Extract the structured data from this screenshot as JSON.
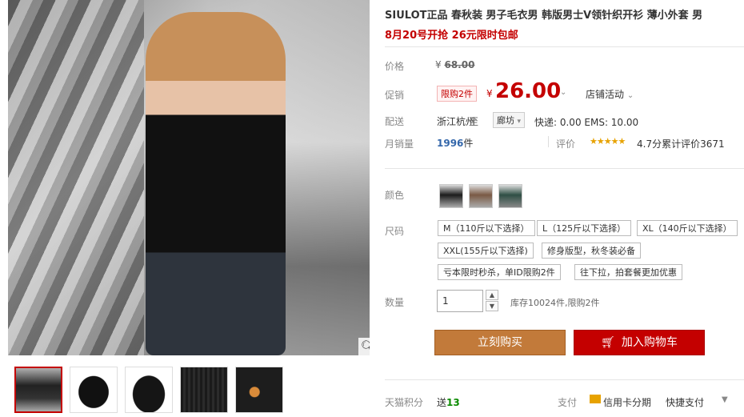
{
  "product": {
    "title": "SIULOT正品 春秋装 男子毛衣男 韩版男士V领针织开衫 薄小外套 男",
    "subtitle": "8月20号开抢 26元限时包邮"
  },
  "price": {
    "label": "价格",
    "currency": "¥",
    "original": "68.00"
  },
  "promo": {
    "label": "促销",
    "limit_tag": "限购2件",
    "currency": "¥",
    "value": "26.00",
    "store_activity": "店铺活动"
  },
  "shipping": {
    "label": "配送",
    "from": "浙江杭州",
    "to_word": "至",
    "destination": "廊坊",
    "fee": "快递: 0.00 EMS: 10.00"
  },
  "sales": {
    "label": "月销量",
    "count": "1996",
    "unit": "件",
    "rating_label": "评价",
    "stars": "★★★★★",
    "rating_text": "4.7分累计评价3671"
  },
  "color": {
    "label": "颜色"
  },
  "size": {
    "label": "尺码",
    "options": [
      "M（110斤以下选择）",
      "L（125斤以下选择）",
      "XL（140斤以下选择）",
      "XXL(155斤以下选择)",
      "修身版型，秋冬装必备",
      "亏本限时秒杀，单ID限购2件",
      "往下拉，拍套餐更加优惠"
    ]
  },
  "quantity": {
    "label": "数量",
    "value": "1",
    "stock": "库存10024件,限购2件"
  },
  "actions": {
    "buy_now": "立刻购买",
    "add_to_cart": "加入购物车"
  },
  "points": {
    "label": "天猫积分",
    "give_word": "送",
    "value": "13"
  },
  "payment": {
    "label": "支付",
    "credit": "信用卡分期",
    "quick": "快捷支付"
  },
  "icons": {
    "zoom": "magnifier-icon",
    "cart": "cart-icon",
    "card": "credit-card-icon"
  },
  "colors": {
    "accent_red": "#c40000",
    "buy_brown": "#c27a3a",
    "link_blue": "#3366aa",
    "star_gold": "#e7a200"
  }
}
